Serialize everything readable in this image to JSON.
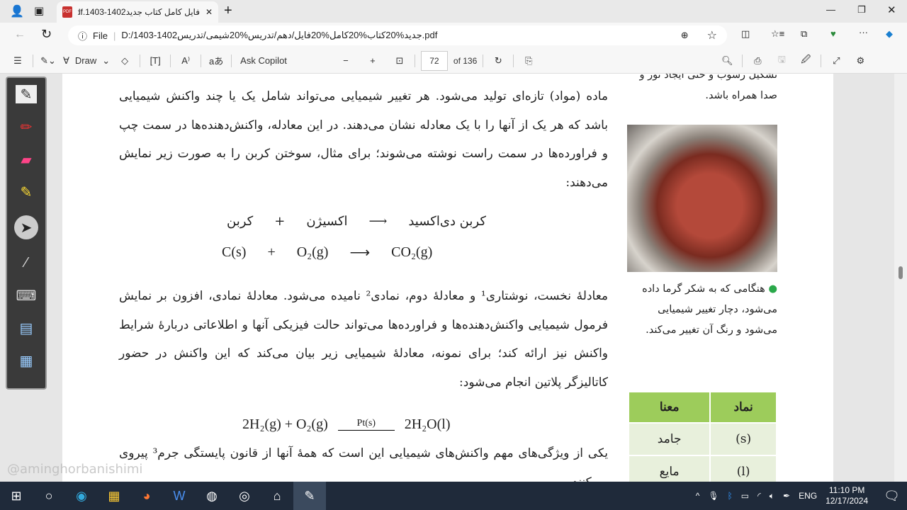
{
  "browser": {
    "tab_title": "فایل کامل کتاب جدید1402-1403.pdf",
    "url_prefix": "File",
    "url": "D:/1403-1402جدید%20کتاب%20کامل%20فایل/دهم/تدریس%20شیمی/تدریس.pdf"
  },
  "toolbar": {
    "draw": "Draw",
    "ask_copilot": "Ask Copilot",
    "page_current": "72",
    "page_total": "of 136"
  },
  "page": {
    "paragraph1": "ماده (مواد) تازه‌ای تولید می‌شود. هر تغییر شیمیایی می‌تواند شامل یک یا چند واکنش شیمیایی باشد که هر یک از آنها را با یک معادله نشان می‌دهند. در این معادله، واکنش‌دهنده‌ها در سمت چپ و فراورده‌ها در سمت راست نوشته می‌شوند؛ برای مثال، سوختن کربن را به صورت زیر نمایش می‌دهند:",
    "word_eq": {
      "reactant1": "کربن",
      "plus": "+",
      "reactant2": "اکسیژن",
      "arrow": "⟶",
      "product": "کربن دی‌اکسید"
    },
    "formula_eq": {
      "reactant1": "C(s)",
      "plus": "+",
      "reactant2": "O₂(g)",
      "arrow": "⟶",
      "product": "CO₂(g)"
    },
    "paragraph2": "معادلهٔ نخست، نوشتاری¹ و معادلهٔ دوم، نمادی² نامیده می‌شود. معادلهٔ نمادی، افزون بر نمایش فرمول شیمیایی واکنش‌دهنده‌ها و فراورده‌ها می‌تواند حالت فیزیکی آنها و اطلاعاتی دربارهٔ شرایط واکنش نیز ارائه کند؛ برای نمونه، معادلهٔ شیمیایی زیر بیان می‌کند که این واکنش در حضور کاتالیزگر پلاتین انجام می‌شود:",
    "catalyst_eq": {
      "left": "2H₂(g) + O₂(g)",
      "catalyst": "Pt(s)",
      "right": "2H₂O(l)"
    },
    "paragraph3": "یکی از ویژگی‌های مهم واکنش‌های شیمیایی این است که همهٔ آنها از قانون پایستگی جرم³ پیروی می‌کنند.",
    "side_top": "تشکیل رسوب و حتی ایجاد نور و صدا همراه باشد.",
    "caption": "هنگامی که به شکر گرما داده می‌شود، دچار تغییر شیمیایی می‌شود و رنگ آن تغییر می‌کند.",
    "table": {
      "headers": [
        "نماد",
        "معنا"
      ],
      "rows": [
        [
          "(s)",
          "جامد"
        ],
        [
          "(l)",
          "مایع"
        ]
      ]
    }
  },
  "watermark": "@aminghorbanishimi",
  "taskbar": {
    "time": "11:10 PM",
    "date": "12/17/2024",
    "lang": "ENG"
  }
}
